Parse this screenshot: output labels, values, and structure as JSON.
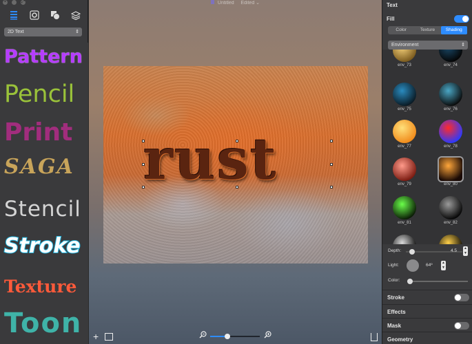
{
  "window": {
    "title": "Untitled",
    "status": "Edited",
    "status_chevron": "⌄"
  },
  "left_sidebar": {
    "icons": [
      "list-icon",
      "gear-icon",
      "shapes-icon",
      "layers-icon"
    ],
    "category_select": {
      "value": "2D Text",
      "chevron": "⇕"
    },
    "styles": [
      {
        "label": "Pattern",
        "color": "#b63cff"
      },
      {
        "label": "Pencil",
        "color": "#9ac23a"
      },
      {
        "label": "Print",
        "color": "#a12d7d"
      },
      {
        "label": "SAGA",
        "color": "#c8a45a"
      },
      {
        "label": "Stencil",
        "color": "#d4d4d4"
      },
      {
        "label": "Stroke",
        "color": "#ffffff"
      },
      {
        "label": "Texture",
        "color": "#ff5a3a"
      },
      {
        "label": "Toon",
        "color": "#3fb3a8"
      }
    ]
  },
  "canvas": {
    "text": "rust",
    "bottom": {
      "add": "+",
      "zoom_out_icon": "zoom-out-icon",
      "zoom_in_icon": "zoom-in-icon",
      "zoom_level": 0.35
    }
  },
  "right_panel": {
    "header": "Text",
    "fill": {
      "label": "Fill",
      "enabled": true
    },
    "tabs": [
      {
        "label": "Color"
      },
      {
        "label": "Texture"
      },
      {
        "label": "Shading",
        "active": true
      }
    ],
    "shading_select": {
      "value": "Environment",
      "chevron": "⇕"
    },
    "environments": [
      {
        "label": "env_73",
        "colors": [
          "#f7d27a",
          "#7a5a1e"
        ]
      },
      {
        "label": "env_74",
        "colors": [
          "#1a4a6a",
          "#050505"
        ]
      },
      {
        "label": "env_75",
        "colors": [
          "#2a8bbf",
          "#0a1a24"
        ]
      },
      {
        "label": "env_76",
        "colors": [
          "#4aa6c4",
          "#0a0a0a"
        ]
      },
      {
        "label": "env_77",
        "colors": [
          "#ffe07a",
          "#f08a1a"
        ]
      },
      {
        "label": "env_78",
        "colors": [
          "#ff2a2a",
          "#2a3aff"
        ]
      },
      {
        "label": "env_79",
        "colors": [
          "#ff9a8a",
          "#7a1a10"
        ]
      },
      {
        "label": "env_80",
        "colors": [
          "#ffa63a",
          "#1a0a05"
        ]
      },
      {
        "label": "env_81",
        "colors": [
          "#6aff4a",
          "#0a1a05"
        ]
      },
      {
        "label": "env_82",
        "colors": [
          "#9a9a9a",
          "#050505"
        ]
      },
      {
        "label": "",
        "colors": [
          "#dadada",
          "#050505"
        ]
      },
      {
        "label": "",
        "colors": [
          "#ffd04a",
          "#050505"
        ]
      }
    ],
    "selected_environment": "env_80",
    "depth": {
      "label": "Depth:",
      "value": "4.5",
      "fraction": 0.06
    },
    "light": {
      "label": "Light:",
      "value": "64º"
    },
    "color": {
      "label": "Color:",
      "fraction": 0.0
    },
    "sections": [
      {
        "label": "Stroke",
        "toggle": false
      },
      {
        "label": "Effects"
      },
      {
        "label": "Mask",
        "toggle": false
      },
      {
        "label": "Geometry"
      }
    ],
    "accent": "#2e8cff"
  }
}
